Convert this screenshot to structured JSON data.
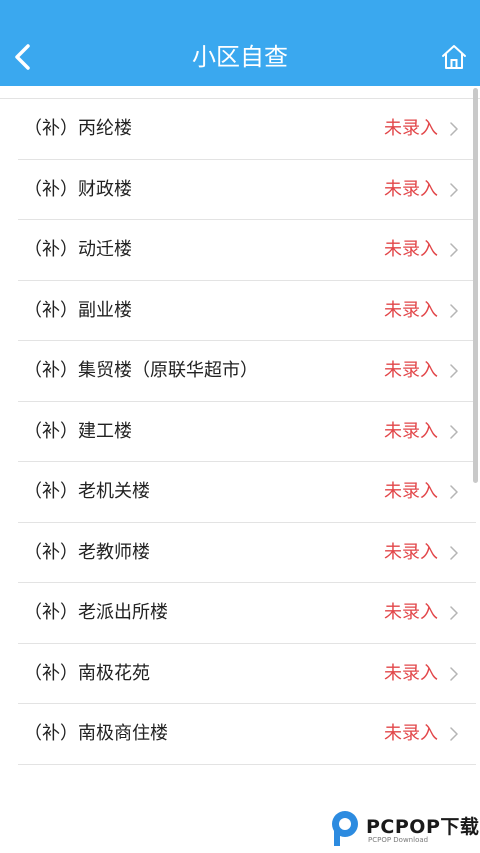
{
  "header": {
    "title": "小区自查",
    "back_icon": "chevron-left-icon",
    "home_icon": "home-icon",
    "bg_color": "#3aa8ef"
  },
  "list": {
    "items": [
      {
        "name": "（补）丙纶楼",
        "status": "未录入"
      },
      {
        "name": "（补）财政楼",
        "status": "未录入"
      },
      {
        "name": "（补）动迁楼",
        "status": "未录入"
      },
      {
        "name": "（补）副业楼",
        "status": "未录入"
      },
      {
        "name": "（补）集贸楼（原联华超市）",
        "status": "未录入"
      },
      {
        "name": "（补）建工楼",
        "status": "未录入"
      },
      {
        "name": "（补）老机关楼",
        "status": "未录入"
      },
      {
        "name": "（补）老教师楼",
        "status": "未录入"
      },
      {
        "name": "（补）老派出所楼",
        "status": "未录入"
      },
      {
        "name": "（补）南极花苑",
        "status": "未录入"
      },
      {
        "name": "（补）南极商住楼",
        "status": "未录入"
      }
    ],
    "status_color": "#e2474a",
    "chevron_icon": "chevron-right-icon"
  },
  "watermark": {
    "brand": "PCPOP下载",
    "sub": "PCPOP Download"
  }
}
